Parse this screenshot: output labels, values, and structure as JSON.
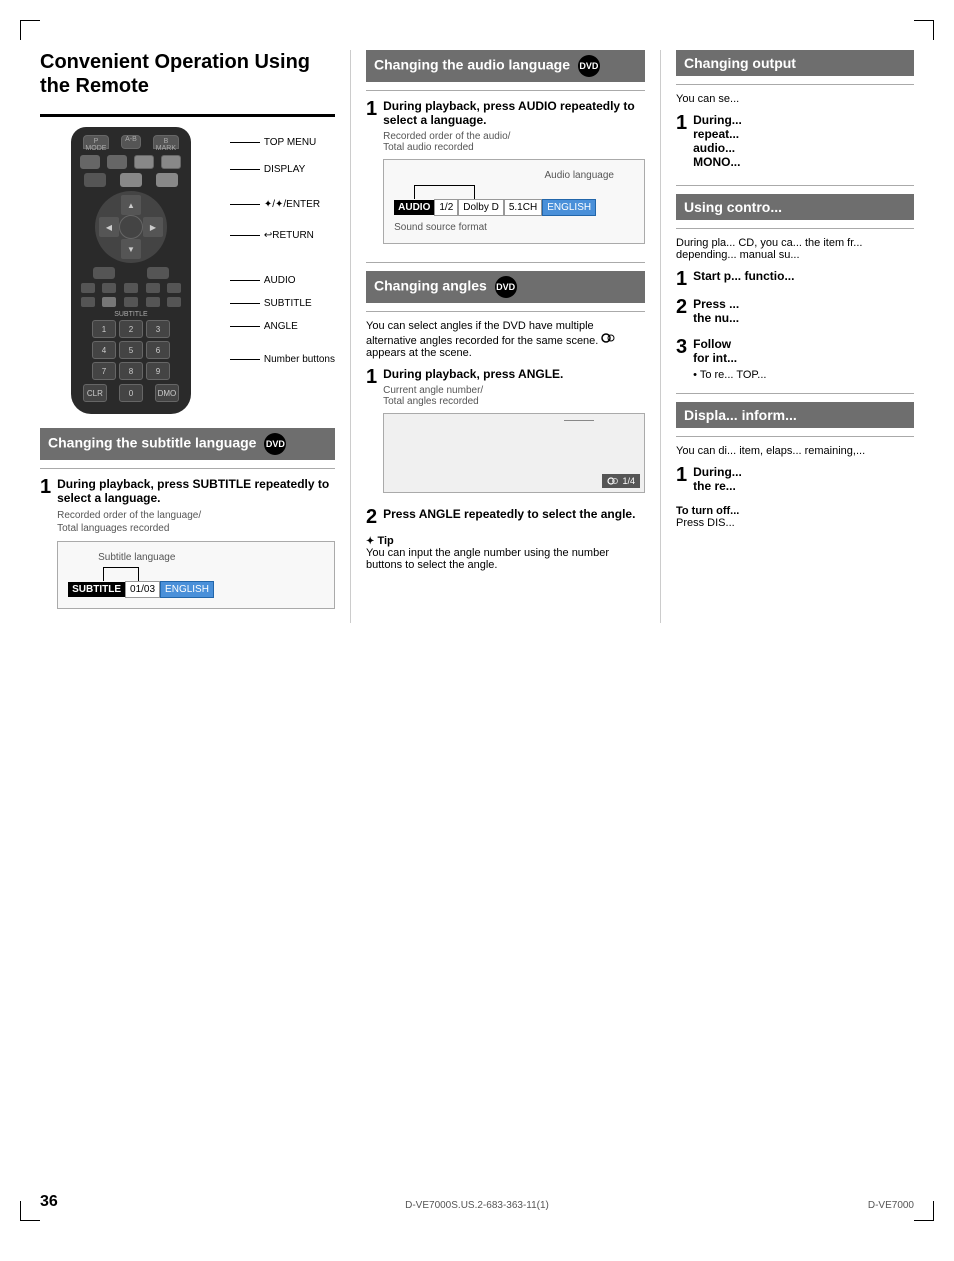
{
  "page": {
    "number": "36",
    "footer_left": "D-VE7000S.US.2-683-363-11(1)",
    "footer_right": "D-VE7000"
  },
  "left_column": {
    "main_title": "Convenient Operation Using the Remote",
    "remote_labels": {
      "top_menu": "TOP MENU",
      "display": "DISPLAY",
      "enter": "✦/✦/ENTER",
      "return": "↩RETURN",
      "audio": "AUDIO",
      "subtitle": "SUBTITLE",
      "angle": "ANGLE",
      "number_buttons": "Number buttons"
    },
    "subtitle_section": {
      "header": "Changing the subtitle language",
      "dvd": "DVD",
      "step1_title": "During playback, press SUBTITLE repeatedly to select a language.",
      "diagram_label1": "Recorded order of the language/",
      "diagram_label2": "Total languages recorded",
      "subtitle_label": "Subtitle language",
      "display_label": "SUBTITLE",
      "display_val1": "01/03",
      "display_val2": "ENGLISH"
    }
  },
  "mid_column": {
    "audio_section": {
      "header": "Changing the audio language",
      "dvd": "DVD",
      "step1_title": "During playback, press AUDIO repeatedly to select a language.",
      "diagram_label1": "Recorded order of the audio/",
      "diagram_label2": "Total audio recorded",
      "audio_label": "Audio language",
      "display_label": "AUDIO",
      "display_val1": "1/2",
      "display_val2": "Dolby D",
      "display_val3": "5.1CH",
      "display_val4": "ENGLISH",
      "sound_source": "Sound source format"
    },
    "angles_section": {
      "header": "Changing angles",
      "dvd": "DVD",
      "intro": "You can select angles if the DVD have multiple alternative angles recorded for the same scene.",
      "icon_note": "appears at the scene.",
      "step1_title": "During playback, press ANGLE.",
      "angle_label": "Current angle number/",
      "angle_label2": "Total angles recorded",
      "angle_display": "1/4",
      "step2_title": "Press ANGLE repeatedly to select the angle.",
      "tip_title": "Tip",
      "tip_text": "You can input the angle number using the number buttons to select the angle."
    }
  },
  "right_column": {
    "output_section": {
      "header": "Chang... output",
      "header_full": "Changing output",
      "intro": "You can se..."
    },
    "step1": {
      "title": "During... repeat... audio... MONO..."
    },
    "using_section": {
      "header": "Using contro...",
      "intro": "During pla... CD, you ca... the item fr... depending... manual su..."
    },
    "step1b": {
      "title": "Start p... functio..."
    },
    "step2b": {
      "title": "Press ... the nu..."
    },
    "step3b": {
      "title": "Follow for int...",
      "bullet": "To re... TOP..."
    },
    "display_section": {
      "header": "Displa... inform...",
      "intro": "You can di... item, elaps... remaining,..."
    },
    "step1c": {
      "title": "During... the re..."
    },
    "turn_off": {
      "title": "To turn off...",
      "text": "Press DIS..."
    }
  }
}
